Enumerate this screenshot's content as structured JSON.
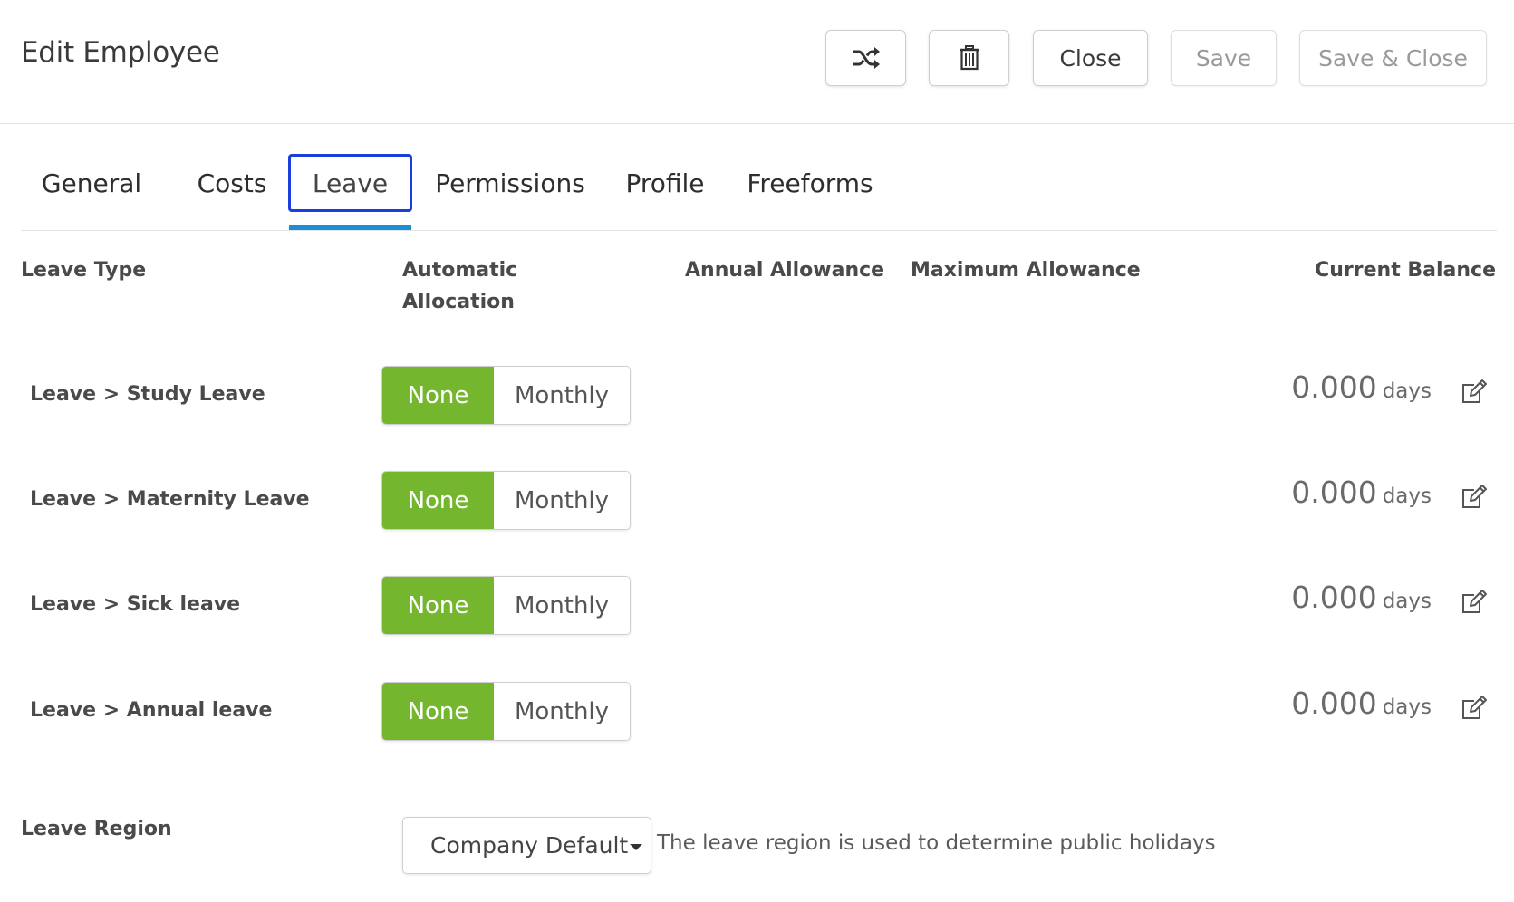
{
  "header": {
    "title": "Edit Employee",
    "shuffle_icon": "shuffle-icon",
    "delete_icon": "trash-icon",
    "close_label": "Close",
    "save_label": "Save",
    "save_close_label": "Save & Close"
  },
  "tabs": [
    {
      "label": "General",
      "active": false
    },
    {
      "label": "Costs",
      "active": false
    },
    {
      "label": "Leave",
      "active": true
    },
    {
      "label": "Permissions",
      "active": false
    },
    {
      "label": "Profile",
      "active": false
    },
    {
      "label": "Freeforms",
      "active": false
    }
  ],
  "table": {
    "columns": {
      "leave_type": "Leave Type",
      "automatic_allocation_line1": "Automatic",
      "automatic_allocation_line2": "Allocation",
      "annual_allowance": "Annual Allowance",
      "maximum_allowance": "Maximum Allowance",
      "current_balance": "Current Balance"
    },
    "rows": [
      {
        "label": "Leave > Study Leave",
        "allocation_options": [
          "None",
          "Monthly"
        ],
        "selected": "None",
        "balance": "0.000",
        "unit": "days"
      },
      {
        "label": "Leave > Maternity Leave",
        "allocation_options": [
          "None",
          "Monthly"
        ],
        "selected": "None",
        "balance": "0.000",
        "unit": "days"
      },
      {
        "label": "Leave > Sick leave",
        "allocation_options": [
          "None",
          "Monthly"
        ],
        "selected": "None",
        "balance": "0.000",
        "unit": "days"
      },
      {
        "label": "Leave > Annual leave",
        "allocation_options": [
          "None",
          "Monthly"
        ],
        "selected": "None",
        "balance": "0.000",
        "unit": "days"
      }
    ]
  },
  "leave_region": {
    "label": "Leave Region",
    "selected": "Company Default",
    "hint": "The leave region is used to determine public holidays"
  },
  "colors": {
    "selected_toggle": "#74b72e",
    "active_tab_border": "#1a3fdc",
    "active_tab_underline": "#1a8fd6"
  }
}
